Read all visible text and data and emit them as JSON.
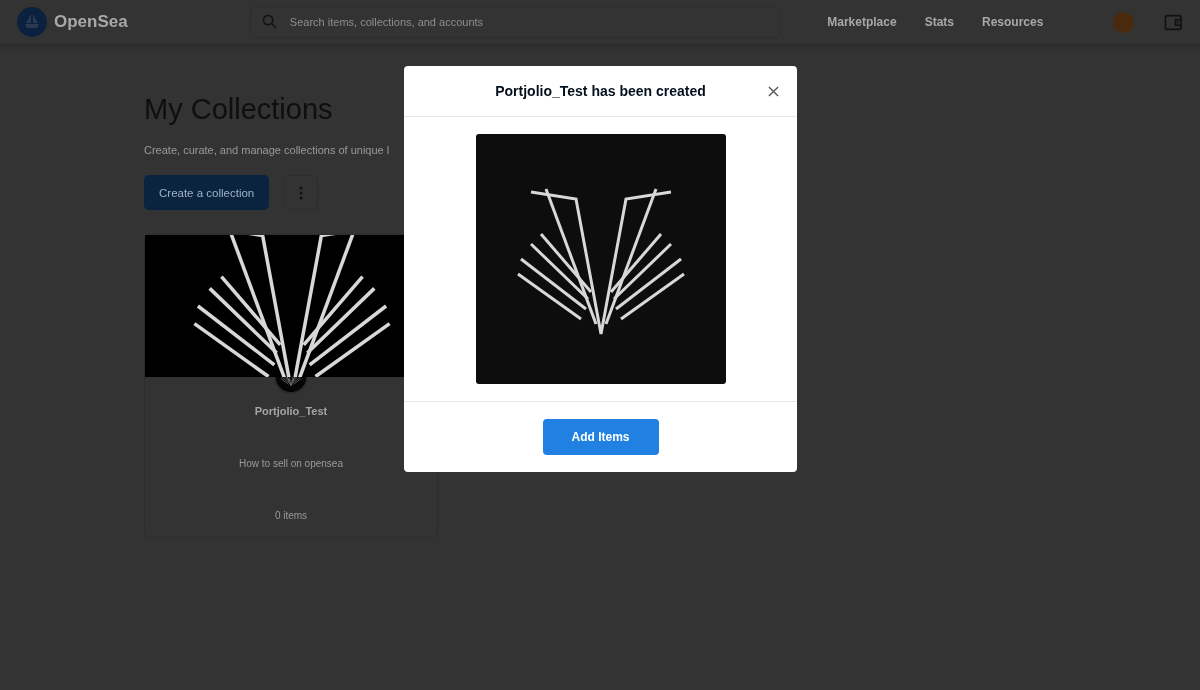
{
  "header": {
    "logo_text": "OpenSea",
    "search": {
      "placeholder": "Search items, collections, and accounts"
    },
    "nav_links": [
      "Marketplace",
      "Stats",
      "Resources"
    ]
  },
  "page": {
    "title": "My Collections",
    "description": "Create, curate, and manage collections of unique l",
    "create_button": "Create a collection"
  },
  "collections": [
    {
      "name": "Portjolio_Test",
      "description": "How to sell on opensea",
      "item_count": "0 items"
    }
  ],
  "modal": {
    "title": "Portjolio_Test has been created",
    "button": "Add Items"
  }
}
